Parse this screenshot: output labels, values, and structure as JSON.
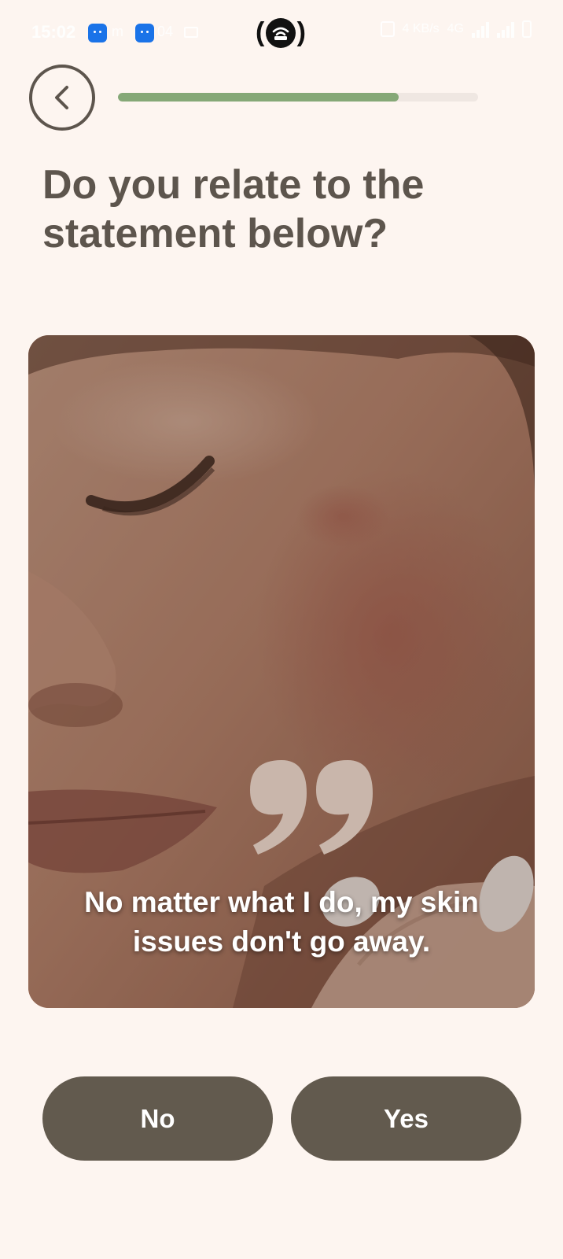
{
  "status_bar": {
    "time": "15:02",
    "app_icon_1_label": "m",
    "app_icon_2_label": "04",
    "network_speed": "4 KB/s",
    "network_type": "4G"
  },
  "header": {
    "back_icon": "chevron-left-icon",
    "progress_fraction": 0.78
  },
  "question": {
    "title": "Do you relate to the statement below?"
  },
  "statement_card": {
    "quote_icon": "closing-quote-icon",
    "text": "No matter what I do, my skin issues don't go away."
  },
  "answers": {
    "no_label": "No",
    "yes_label": "Yes"
  },
  "colors": {
    "background": "#fdf5f0",
    "text_primary": "#5d554d",
    "progress_fill": "#85a877",
    "progress_track": "#efe7e2",
    "button": "#625a4e",
    "quote": "#c9b6ab"
  }
}
